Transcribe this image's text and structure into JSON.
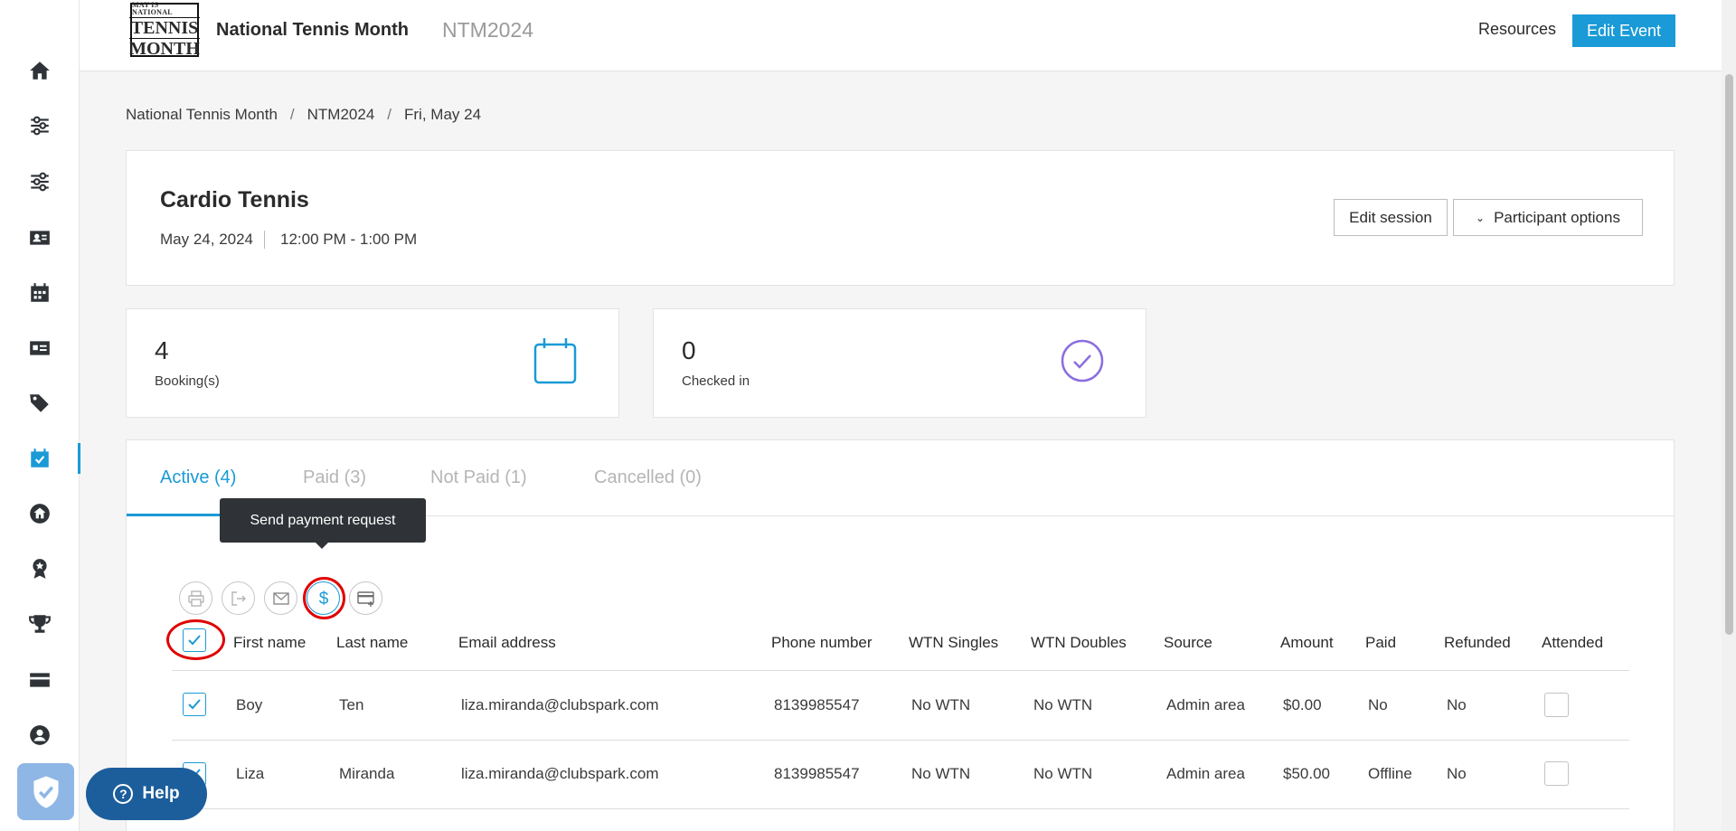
{
  "header": {
    "logo_line1": "MAY IS NATIONAL",
    "logo_line2": "TENNIS",
    "logo_line3": "MONTH",
    "event_name": "National Tennis Month",
    "event_code": "NTM2024",
    "resources_label": "Resources",
    "edit_event_label": "Edit Event"
  },
  "breadcrumb": {
    "items": [
      "National Tennis Month",
      "NTM2024",
      "Fri, May 24"
    ],
    "separator": "/"
  },
  "session": {
    "title": "Cardio Tennis",
    "date": "May 24, 2024",
    "time": "12:00 PM - 1:00 PM",
    "edit_label": "Edit session",
    "participant_label": "Participant options"
  },
  "stats": {
    "bookings_value": "4",
    "bookings_label": "Booking(s)",
    "checked_value": "0",
    "checked_label": "Checked in"
  },
  "tabs": [
    {
      "label": "Active (4)"
    },
    {
      "label": "Paid (3)"
    },
    {
      "label": "Not Paid (1)"
    },
    {
      "label": "Cancelled (0)"
    }
  ],
  "tooltip": "Send payment request",
  "columns": [
    "First name",
    "Last name",
    "Email address",
    "Phone number",
    "WTN Singles",
    "WTN Doubles",
    "Source",
    "Amount",
    "Paid",
    "Refunded",
    "Attended"
  ],
  "rows": [
    {
      "first": "Boy",
      "last": "Ten",
      "email": "liza.miranda@clubspark.com",
      "phone": "8139985547",
      "wtn_singles": "No WTN",
      "wtn_doubles": "No WTN",
      "source": "Admin area",
      "amount": "$0.00",
      "paid": "No",
      "refunded": "No"
    },
    {
      "first": "Liza",
      "last": "Miranda",
      "email": "liza.miranda@clubspark.com",
      "phone": "8139985547",
      "wtn_singles": "No WTN",
      "wtn_doubles": "No WTN",
      "source": "Admin area",
      "amount": "$50.00",
      "paid": "Offline",
      "refunded": "No"
    }
  ],
  "help_label": "Help",
  "colors": {
    "accent": "#1a9ad6",
    "highlight_ring": "#e00000",
    "check_purple": "#8a6ee0"
  }
}
